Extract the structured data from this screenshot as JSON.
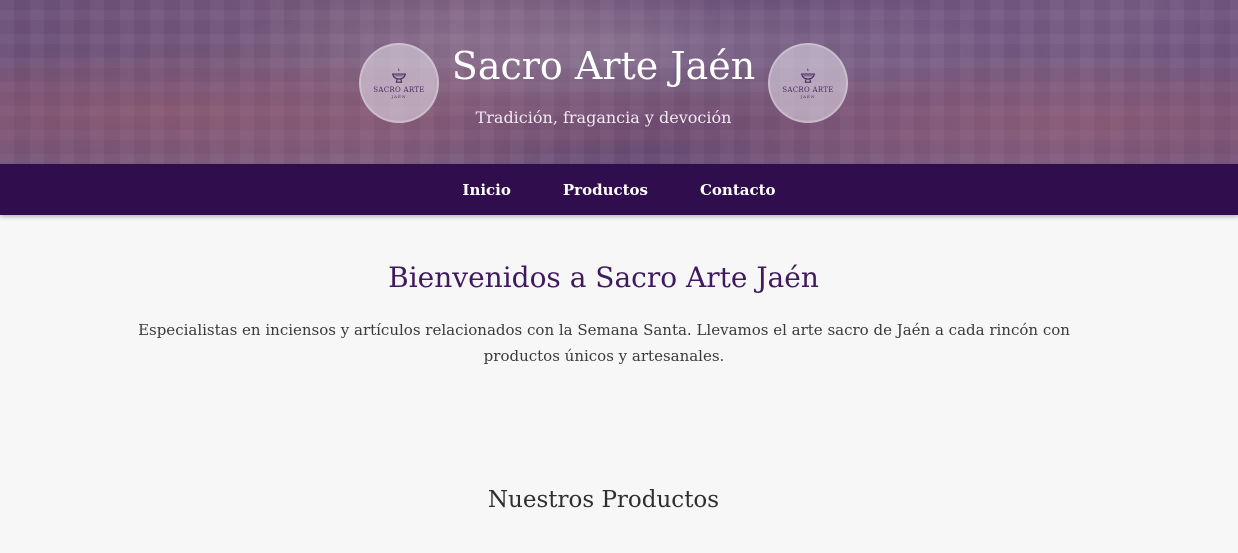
{
  "header": {
    "title": "Sacro Arte Jaén",
    "tagline": "Tradición, fragancia y devoción",
    "logo": {
      "icon": "incense-burner-icon",
      "text": "SACRO ARTE",
      "subtext": "JAÉN"
    }
  },
  "nav": {
    "items": [
      {
        "label": "Inicio"
      },
      {
        "label": "Productos"
      },
      {
        "label": "Contacto"
      }
    ]
  },
  "welcome": {
    "title": "Bienvenidos a Sacro Arte Jaén",
    "text": "Especialistas en inciensos y artículos relacionados con la Semana Santa. Llevamos el arte sacro de Jaén a cada rincón con productos únicos y artesanales."
  },
  "products": {
    "title": "Nuestros Productos"
  },
  "colors": {
    "nav_background": "#300d4d",
    "accent": "#3f1a5e",
    "page_background": "#f8f7f8"
  }
}
